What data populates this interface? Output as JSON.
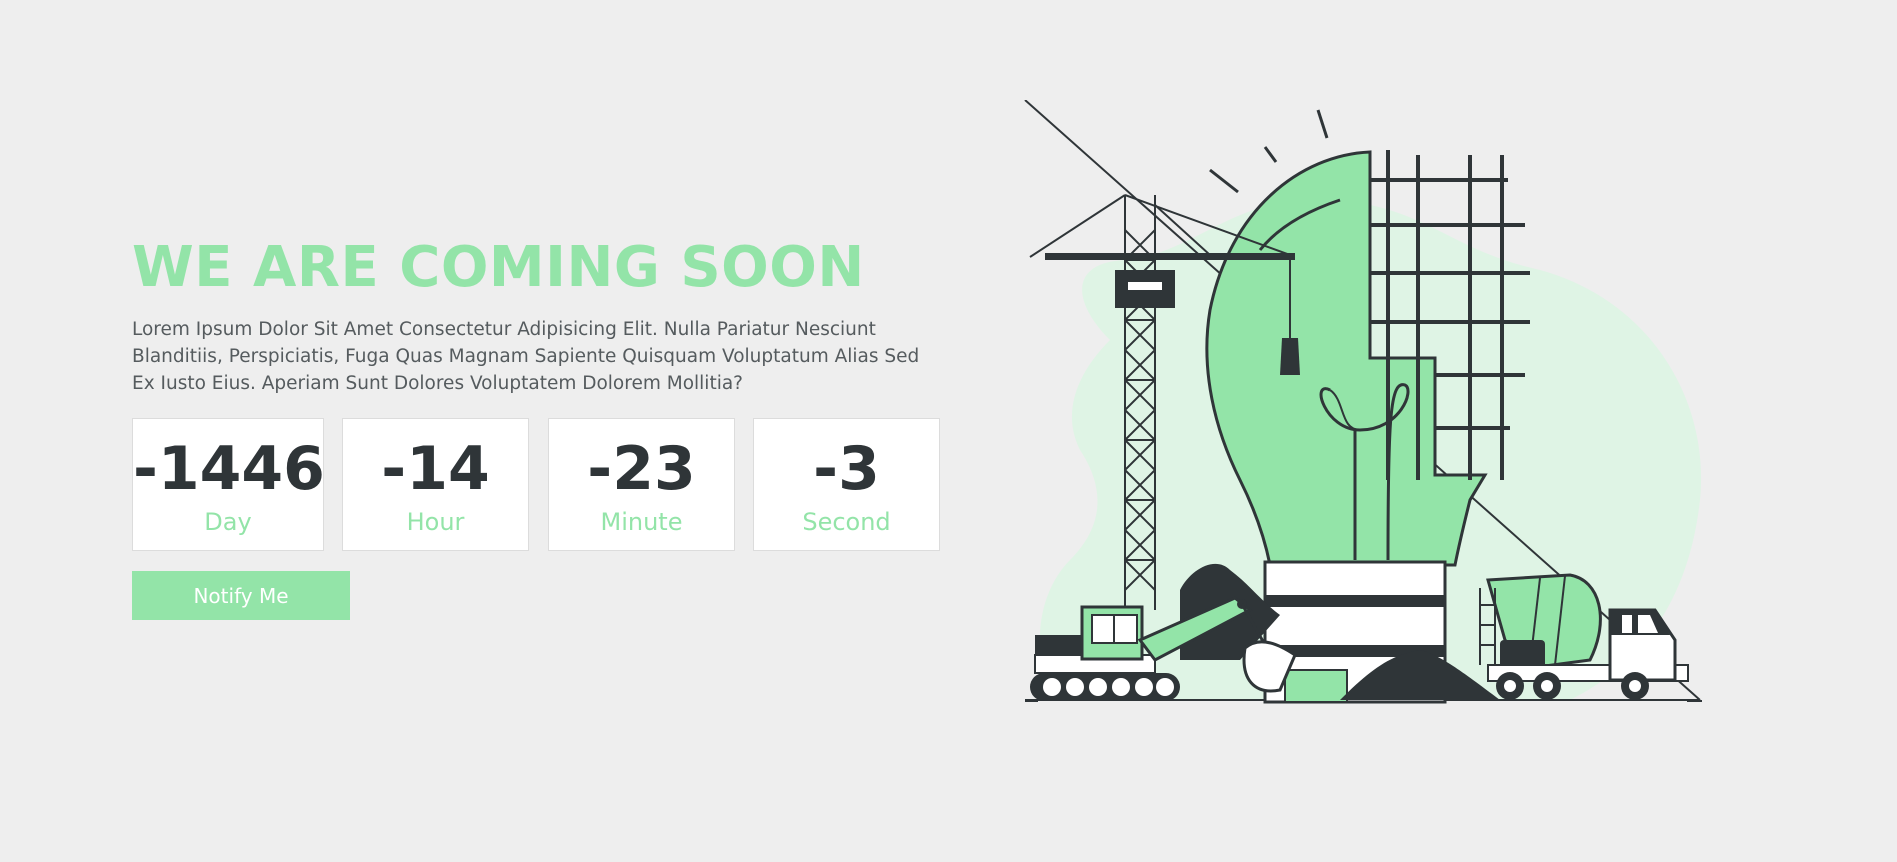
{
  "hero": {
    "title": "WE ARE COMING SOON",
    "description": "Lorem Ipsum Dolor Sit Amet Consectetur Adipisicing Elit. Nulla Pariatur Nesciunt Blanditiis, Perspiciatis, Fuga Quas Magnam Sapiente Quisquam Voluptatum Alias Sed Ex Iusto Eius. Aperiam Sunt Dolores Voluptatem Dolorem Mollitia?"
  },
  "countdown": {
    "day": {
      "value": "-1446",
      "label": "Day"
    },
    "hour": {
      "value": "-14",
      "label": "Hour"
    },
    "minute": {
      "value": "-23",
      "label": "Minute"
    },
    "second": {
      "value": "-3",
      "label": "Second"
    }
  },
  "cta": {
    "label": "Notify Me"
  },
  "colors": {
    "accent": "#93e4a8",
    "dark": "#2f3538",
    "background": "#eeeeee",
    "card": "#ffffff"
  },
  "illustration": {
    "icon": "construction-lightbulb-illustration"
  }
}
